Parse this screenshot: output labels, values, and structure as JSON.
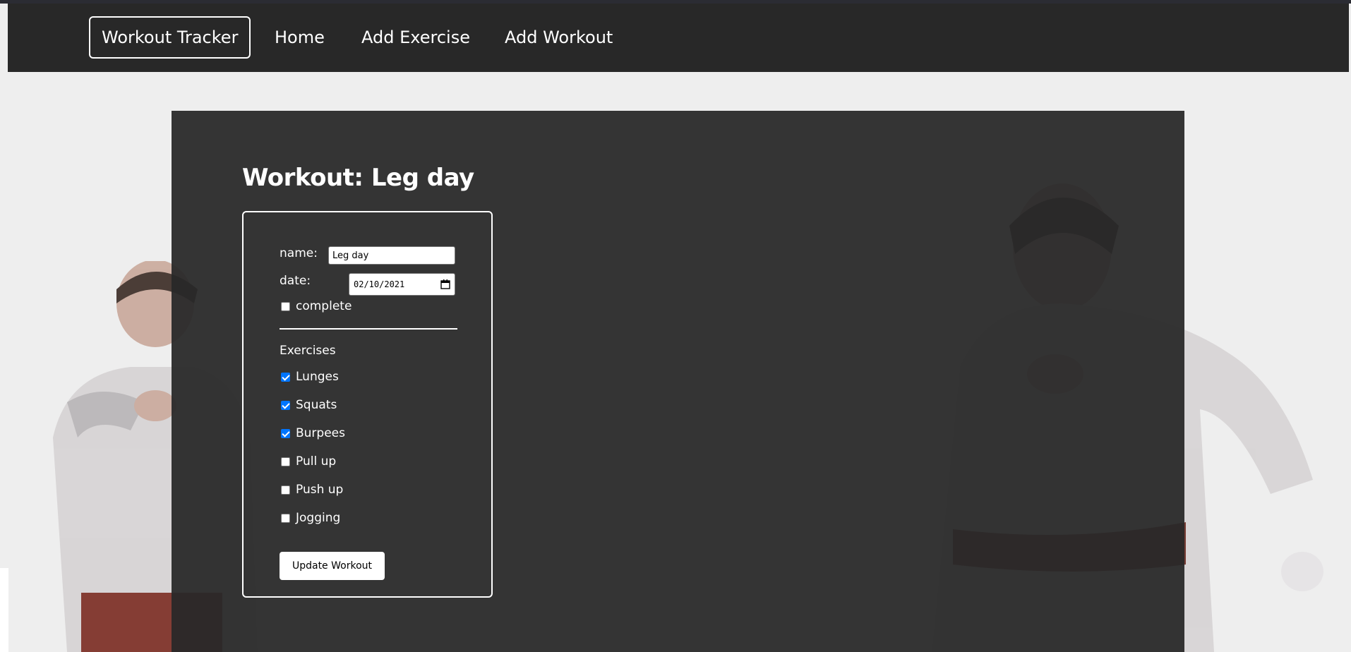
{
  "nav": {
    "brand": "Workout Tracker",
    "links": [
      "Home",
      "Add Exercise",
      "Add Workout"
    ]
  },
  "page": {
    "title": "Workout: Leg day"
  },
  "form": {
    "name_label": "name:",
    "name_value": "Leg day",
    "date_label": "date:",
    "date_value": "02/10/2021",
    "complete_label": "complete",
    "complete_checked": false,
    "exercises_heading": "Exercises",
    "exercises": [
      {
        "label": "Lunges",
        "checked": true
      },
      {
        "label": "Squats",
        "checked": true
      },
      {
        "label": "Burpees",
        "checked": true
      },
      {
        "label": "Pull up",
        "checked": false
      },
      {
        "label": "Push up",
        "checked": false
      },
      {
        "label": "Jogging",
        "checked": false
      }
    ],
    "submit_label": "Update Workout"
  },
  "colors": {
    "navbar": "#282828",
    "panel": "#2f2f2f",
    "page_bg": "#eeeeee",
    "checkbox_accent": "#0075ff"
  }
}
